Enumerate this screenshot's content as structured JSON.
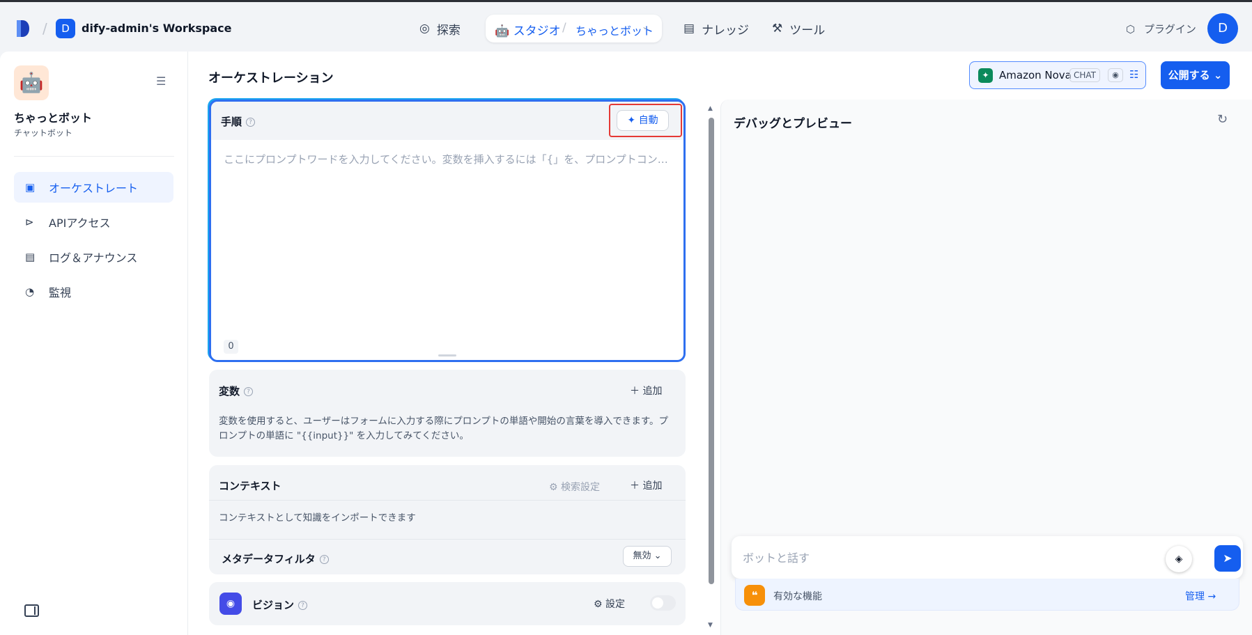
{
  "header": {
    "workspace_initial": "D",
    "workspace_name": "dify-admin's Workspace",
    "nav": {
      "explore": "探索",
      "studio": "スタジオ",
      "app_name": "ちゃっとボット",
      "knowledge": "ナレッジ",
      "tools": "ツール"
    },
    "plugins": "プラグイン",
    "user_initial": "D"
  },
  "sidebar": {
    "app_name": "ちゃっとボット",
    "app_type": "チャットボット",
    "items": [
      {
        "label": "オーケストレート",
        "icon": "layout-icon",
        "active": true
      },
      {
        "label": "APIアクセス",
        "icon": "terminal-icon",
        "active": false
      },
      {
        "label": "ログ＆アナウンス",
        "icon": "file-list-icon",
        "active": false
      },
      {
        "label": "監視",
        "icon": "gauge-icon",
        "active": false
      }
    ]
  },
  "main": {
    "title": "オーケストレーション",
    "model": {
      "name": "Amazon Nova",
      "mode": "CHAT"
    },
    "publish_label": "公開する",
    "prompt": {
      "title": "手順",
      "auto_label": "自動",
      "placeholder": "ここにプロンプトワードを入力してください。変数を挿入するには「{」を、プロンプトコンテンツブロックを挿...",
      "char_count": "0"
    },
    "variables": {
      "title": "変数",
      "add_label": "追加",
      "description": "変数を使用すると、ユーザーはフォームに入力する際にプロンプトの単語や開始の言葉を導入できます。プロンプトの単語に \"{{input}}\" を入力してみてください。"
    },
    "context": {
      "title": "コンテキスト",
      "search_settings": "検索設定",
      "add_label": "追加",
      "description": "コンテキストとして知識をインポートできます",
      "metadata_filter": "メタデータフィルタ",
      "filter_value": "無効"
    },
    "vision": {
      "title": "ビジョン",
      "settings_label": "設定",
      "enabled": false
    }
  },
  "debug": {
    "title": "デバッグとプレビュー",
    "chat_placeholder": "ボットと話す",
    "features_label": "有効な機能",
    "manage_label": "管理"
  },
  "colors": {
    "accent": "#155eef",
    "highlight_frame": "#e53935",
    "features_icon": "#f79009",
    "vision_icon": "#444ce7"
  }
}
